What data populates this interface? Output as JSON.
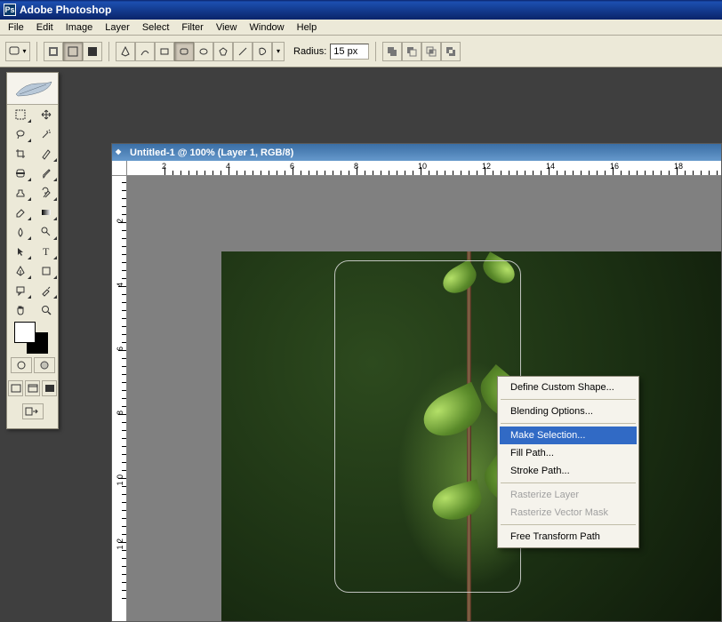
{
  "app_title": "Adobe Photoshop",
  "menubar": [
    "File",
    "Edit",
    "Image",
    "Layer",
    "Select",
    "Filter",
    "View",
    "Window",
    "Help"
  ],
  "options": {
    "radius_label": "Radius:",
    "radius_value": "15 px"
  },
  "document": {
    "title": "Untitled-1 @ 100% (Layer 1, RGB/8)",
    "ruler_h": [
      "2",
      "4",
      "6",
      "8",
      "10",
      "12",
      "14",
      "16",
      "18"
    ],
    "ruler_v": [
      "0",
      "2",
      "4",
      "6",
      "8",
      "1 0",
      "1 2"
    ]
  },
  "context_menu": {
    "items": [
      {
        "label": "Define Custom Shape...",
        "disabled": false
      },
      {
        "sep": true
      },
      {
        "label": "Blending Options...",
        "disabled": false
      },
      {
        "sep": true
      },
      {
        "label": "Make Selection...",
        "disabled": false,
        "highlighted": true
      },
      {
        "label": "Fill Path...",
        "disabled": false
      },
      {
        "label": "Stroke Path...",
        "disabled": false
      },
      {
        "sep": true
      },
      {
        "label": "Rasterize Layer",
        "disabled": true
      },
      {
        "label": "Rasterize Vector Mask",
        "disabled": true
      },
      {
        "sep": true
      },
      {
        "label": "Free Transform Path",
        "disabled": false
      }
    ]
  },
  "tools": [
    "marquee",
    "move",
    "lasso",
    "wand",
    "crop",
    "slice",
    "healing",
    "brush",
    "stamp",
    "history-brush",
    "eraser",
    "gradient",
    "blur",
    "dodge",
    "path-select",
    "type",
    "pen",
    "shape",
    "notes",
    "eyedropper",
    "hand",
    "zoom"
  ],
  "colors": {
    "fg": "#ffffff",
    "bg": "#000000"
  }
}
